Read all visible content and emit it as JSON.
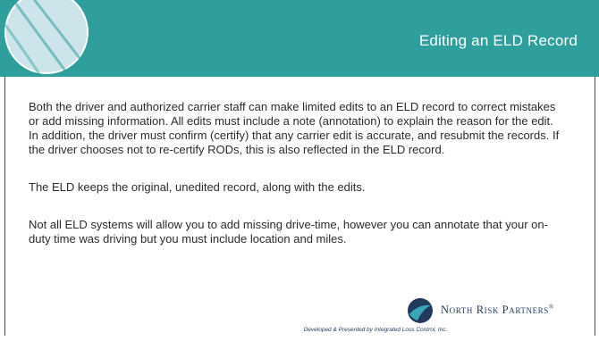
{
  "slide": {
    "title": "Editing an ELD Record",
    "paragraphs": [
      "Both the driver and authorized carrier staff can make limited edits to an ELD record to correct mistakes or add missing information. All edits must include a note (annotation) to explain the reason for the edit. In addition, the driver must confirm (certify) that any carrier edit is accurate, and resubmit the records. If the driver chooses not to re-certify RODs, this is also reflected in the ELD record.",
      "The ELD keeps the original, unedited record, along with the edits.",
      "Not all ELD systems will allow you to add missing drive-time, however you can annotate that your on-duty time was driving but you must include location and miles."
    ]
  },
  "branding": {
    "name": "North Risk Partners",
    "trademark": "®",
    "footer": "Developed & Presented by Integrated Loss Control, Inc."
  },
  "colors": {
    "header": "#2e9f9c",
    "brand_navy": "#1f3a5c",
    "brand_teal": "#3aa6b9"
  },
  "icons": {
    "header_logo": "globe-arcs-icon",
    "brand_mark": "north-risk-circle-icon"
  }
}
